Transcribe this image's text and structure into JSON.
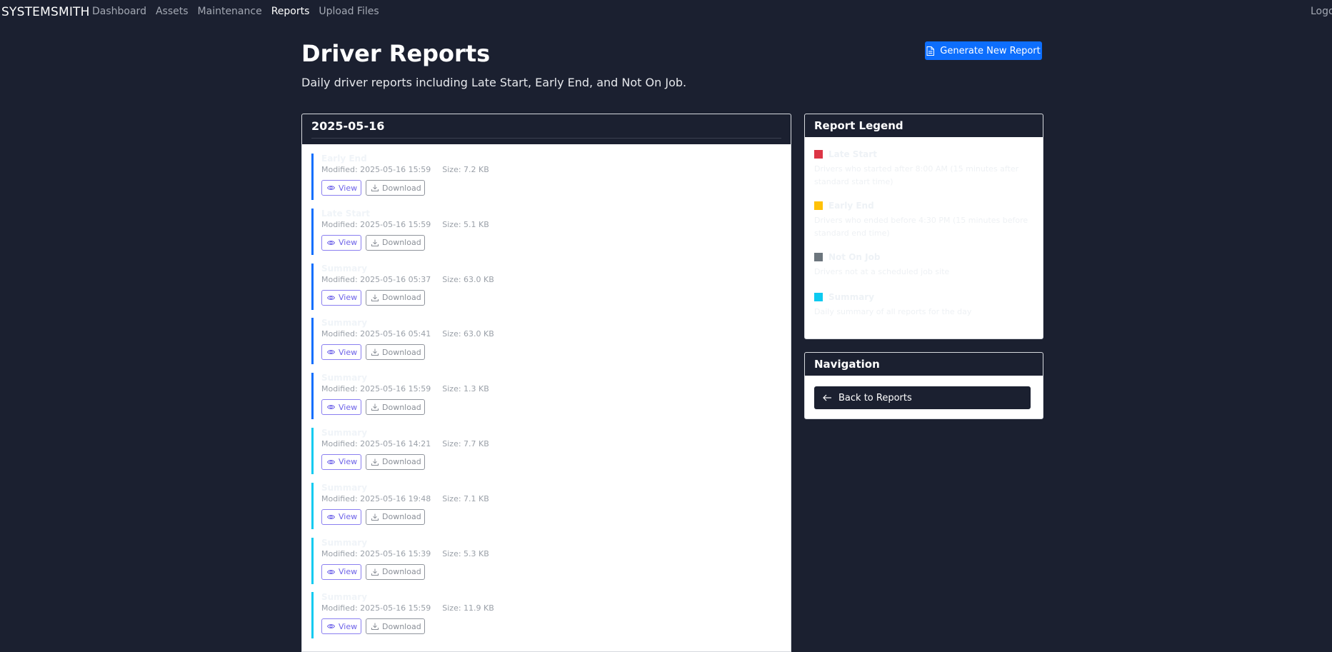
{
  "nav": {
    "brand": "SYSTEMSMITH",
    "links": [
      "Dashboard",
      "Assets",
      "Maintenance",
      "Reports",
      "Upload Files"
    ],
    "active": "Reports",
    "logout": "Logout"
  },
  "header": {
    "title": "Driver Reports",
    "subtitle": "Daily driver reports including Late Start, Early End, and Not On Job.",
    "generate_label": "Generate New Report"
  },
  "main": {
    "date": "2025-05-16",
    "view_label": "View",
    "download_label": "Download",
    "reports": [
      {
        "title": "Early End",
        "modified": "Modified: 2025-05-16 15:59",
        "size": "Size: 7.2 KB",
        "accent": "blue"
      },
      {
        "title": "Late Start",
        "modified": "Modified: 2025-05-16 15:59",
        "size": "Size: 5.1 KB",
        "accent": "blue"
      },
      {
        "title": "Summary",
        "modified": "Modified: 2025-05-16 05:37",
        "size": "Size: 63.0 KB",
        "accent": "blue"
      },
      {
        "title": "Summary",
        "modified": "Modified: 2025-05-16 05:41",
        "size": "Size: 63.0 KB",
        "accent": "blue"
      },
      {
        "title": "Summary",
        "modified": "Modified: 2025-05-16 15:59",
        "size": "Size: 1.3 KB",
        "accent": "blue"
      },
      {
        "title": "Summary",
        "modified": "Modified: 2025-05-16 14:21",
        "size": "Size: 7.7 KB",
        "accent": "cyan"
      },
      {
        "title": "Summary",
        "modified": "Modified: 2025-05-16 19:48",
        "size": "Size: 7.1 KB",
        "accent": "cyan"
      },
      {
        "title": "Summary",
        "modified": "Modified: 2025-05-16 15:39",
        "size": "Size: 5.3 KB",
        "accent": "cyan"
      },
      {
        "title": "Summary",
        "modified": "Modified: 2025-05-16 15:59",
        "size": "Size: 11.9 KB",
        "accent": "cyan"
      }
    ]
  },
  "legend": {
    "title": "Report Legend",
    "items": [
      {
        "label": "Late Start",
        "color": "#dc3545",
        "desc": "Drivers who started after 8:00 AM (15 minutes after standard start time)"
      },
      {
        "label": "Early End",
        "color": "#ffc107",
        "desc": "Drivers who ended before 4:30 PM (15 minutes before standard end time)"
      },
      {
        "label": "Not On Job",
        "color": "#6c757d",
        "desc": "Drivers not at a scheduled job site"
      },
      {
        "label": "Summary",
        "color": "#0dcaf0",
        "desc": "Daily summary of all reports for the day"
      }
    ]
  },
  "navigation": {
    "title": "Navigation",
    "back_label": "Back to Reports"
  },
  "colors": {
    "background": "#1b2030",
    "primary": "#0d6efd",
    "info": "#0dcaf0"
  }
}
